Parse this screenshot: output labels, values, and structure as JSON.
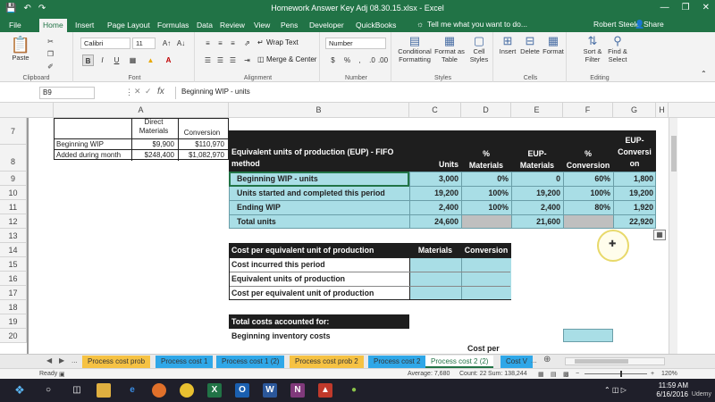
{
  "title_bar": {
    "document_title": "Homework Answer Key Adj 08.30.15.xlsx - Excel",
    "qat_icons": [
      "save-icon",
      "undo-icon",
      "redo-icon"
    ],
    "window_controls": [
      "minimize-icon",
      "restore-icon",
      "close-icon"
    ]
  },
  "tabs": {
    "items": [
      "File",
      "Home",
      "Insert",
      "Page Layout",
      "Formulas",
      "Data",
      "Review",
      "View",
      "Pens",
      "Developer",
      "QuickBooks"
    ],
    "active": "Home",
    "tell_me": "Tell me what you want to do...",
    "user": "Robert Steele",
    "share": "Share"
  },
  "ribbon": {
    "clipboard": {
      "paste": "Paste",
      "label": "Clipboard"
    },
    "font": {
      "name": "Calibri",
      "size": "11",
      "label": "Font",
      "bold": "B",
      "italic": "I",
      "underline": "U"
    },
    "alignment": {
      "wrap_text": "Wrap Text",
      "merge_center": "Merge & Center",
      "label": "Alignment"
    },
    "number": {
      "format": "Number",
      "currency": "$",
      "percent": "%",
      "comma": ",",
      "label": "Number"
    },
    "styles": {
      "conditional": [
        "Conditional",
        "Formatting"
      ],
      "format_table": [
        "Format as",
        "Table"
      ],
      "cell_styles": [
        "Cell",
        "Styles"
      ],
      "label": "Styles"
    },
    "cells": {
      "insert": "Insert",
      "delete": "Delete",
      "format": "Format",
      "label": "Cells"
    },
    "editing": {
      "sort": [
        "Sort &",
        "Filter"
      ],
      "find": [
        "Find &",
        "Select"
      ],
      "label": "Editing"
    }
  },
  "formula_bar": {
    "name_box": "B9",
    "fx": "fx",
    "formula": "Beginning WIP - units"
  },
  "columns": [
    "A",
    "B",
    "C",
    "D",
    "E",
    "F",
    "G",
    "H"
  ],
  "rows": [
    "7",
    "8",
    "9",
    "10",
    "11",
    "12",
    "13",
    "14",
    "15",
    "16",
    "17",
    "18",
    "19",
    "20"
  ],
  "sheet": {
    "frozen_header": {
      "direct_materials": [
        "Direct",
        "Materials"
      ],
      "conversion": "Conversion",
      "beg_wip_label": "Beginning WIP",
      "beg_wip_dm": "$9,900",
      "beg_wip_conv": "$110,970",
      "added_label": "Added during month",
      "added_dm": "$248,400",
      "added_conv": "$1,082,970"
    },
    "eup": {
      "title": [
        "Equivalent units of production (EUP) - FIFO",
        "method"
      ],
      "h_units": "Units",
      "h_pct_materials": [
        "%",
        "Materials"
      ],
      "h_eup_materials": [
        "EUP-",
        "Materials"
      ],
      "h_pct_conversion": [
        "%",
        "Conversion"
      ],
      "h_eup_conversion": [
        "EUP-",
        "Conversi",
        "on"
      ],
      "rows": [
        {
          "label": "Beginning WIP - units",
          "units": "3,000",
          "pct_mat": "0%",
          "eup_mat": "0",
          "pct_conv": "60%",
          "eup_conv": "1,800"
        },
        {
          "label": "Units started and completed this period",
          "units": "19,200",
          "pct_mat": "100%",
          "eup_mat": "19,200",
          "pct_conv": "100%",
          "eup_conv": "19,200"
        },
        {
          "label": "Ending WIP",
          "units": "2,400",
          "pct_mat": "100%",
          "eup_mat": "2,400",
          "pct_conv": "80%",
          "eup_conv": "1,920"
        }
      ],
      "total_label": "Total units",
      "total_units": "24,600",
      "total_eup_mat": "21,600",
      "total_eup_conv": "22,920"
    },
    "cost_per_eu": {
      "title": "Cost per equivalent unit of production",
      "h_materials": "Materials",
      "h_conversion": "Conversion",
      "rows": [
        "Cost incurred this period",
        "Equivalent units of production",
        "Cost per equivalent unit of production"
      ]
    },
    "costs_accounted": {
      "title": "Total costs accounted for:",
      "beginning": "Beginning inventory costs",
      "cost_per": "Cost per"
    }
  },
  "sheet_tabs": {
    "ellipsis": "...",
    "items": [
      {
        "label": "Process cost prob",
        "color": "#f6c243"
      },
      {
        "label": "Process cost 1",
        "color": "#2fa7e8"
      },
      {
        "label": "Process cost 1 (2)",
        "color": "#2fa7e8"
      },
      {
        "label": "Process cost prob 2",
        "color": "#f6c243"
      },
      {
        "label": "Process cost 2",
        "color": "#2fa7e8"
      },
      {
        "label": "Process cost 2 (2)",
        "color": "#ffffff"
      },
      {
        "label": "Cost V",
        "color": "#2fa7e8"
      }
    ],
    "active_index": 5
  },
  "status_bar": {
    "ready": "Ready",
    "average": "Average: 7,680",
    "count": "Count: 22",
    "sum": "Sum: 138,244",
    "zoom": "120%"
  },
  "taskbar": {
    "time": "11:59 AM",
    "date": "6/16/2016",
    "watermark": "Udemy",
    "apps": [
      "windows-icon",
      "cortana-icon",
      "task-view-icon",
      "file-explorer-icon",
      "edge-icon",
      "firefox-icon",
      "chrome-icon",
      "excel-icon",
      "outlook-icon",
      "word-icon",
      "onenote-icon",
      "acrobat-icon",
      "paint-icon"
    ]
  },
  "colors": {
    "excel_green": "#217346",
    "header_dark": "#1e1e1e",
    "teal_fill": "#a9dee6",
    "teal_fill_dark": "#8fc8d2",
    "gray_fill": "#bfbfbf"
  }
}
